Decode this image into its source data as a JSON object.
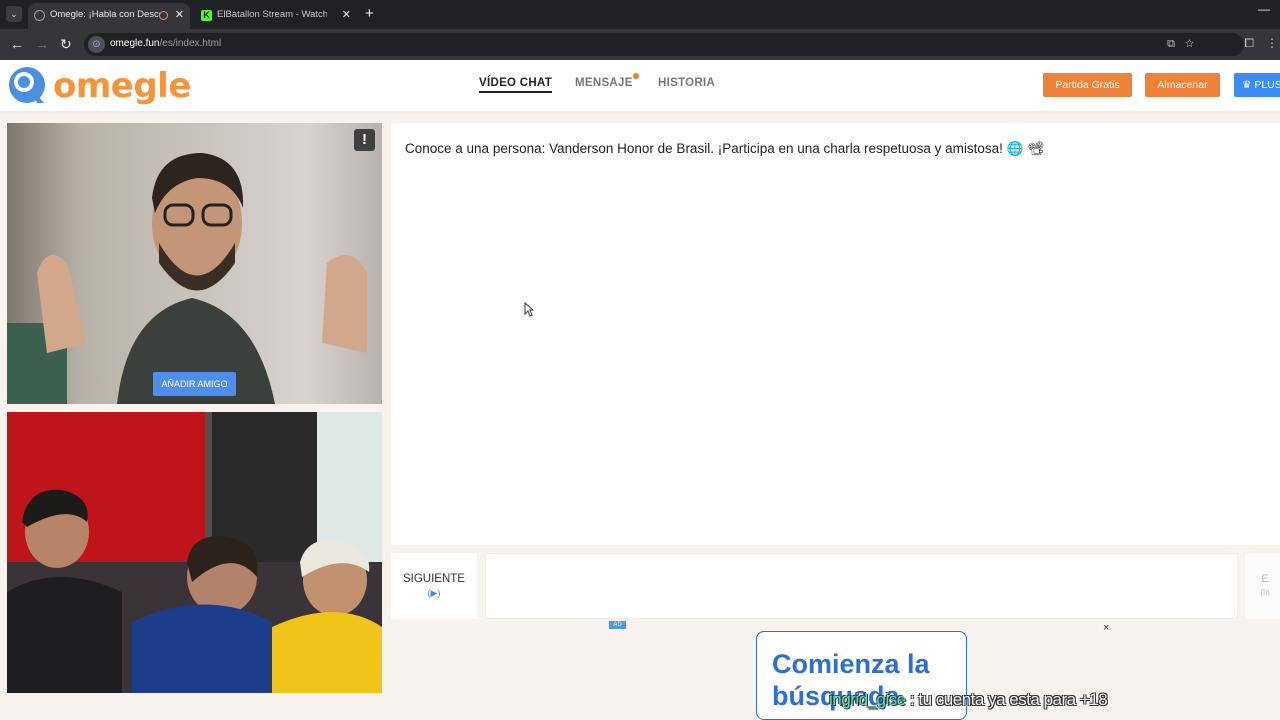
{
  "browser": {
    "tabs": [
      {
        "title": "Omegle: ¡Habla con Descon",
        "icon": "globe-icon",
        "recording": true
      },
      {
        "title": "ElBatallon Stream - Watch Live",
        "icon": "kick-icon"
      }
    ],
    "kick_letter": "K",
    "url_host": "omegle.fun",
    "url_path": "/es/index.html"
  },
  "site": {
    "logo_text": "omegle",
    "brand_color": "#f7943a",
    "nav": {
      "video_chat": "VÍDEO CHAT",
      "message": "MENSAJE",
      "history": "HISTORIA"
    },
    "buttons": {
      "free_game": "Partida Gratis",
      "store": "Almacenar",
      "plus": "PLUS"
    }
  },
  "video": {
    "report_label": "!",
    "add_friend": "AÑADIR AMIGO"
  },
  "chat": {
    "message": "Conoce a una persona: Vanderson Honor de Brasil. ¡Participa en una charla respetuosa y amistosa! 🌐 📽",
    "next_label": "SIGUIENTE",
    "next_hint": "(▶)",
    "input_value": "",
    "send_label": "E",
    "send_hint": "(In"
  },
  "ad": {
    "badge": "AD",
    "close": "×",
    "headline": "Comienza la",
    "subline": "búsqueda"
  },
  "stream_chat": {
    "user": "ingrid_gise",
    "separator": " : ",
    "message": "tu cuenta ya esta para +18"
  }
}
